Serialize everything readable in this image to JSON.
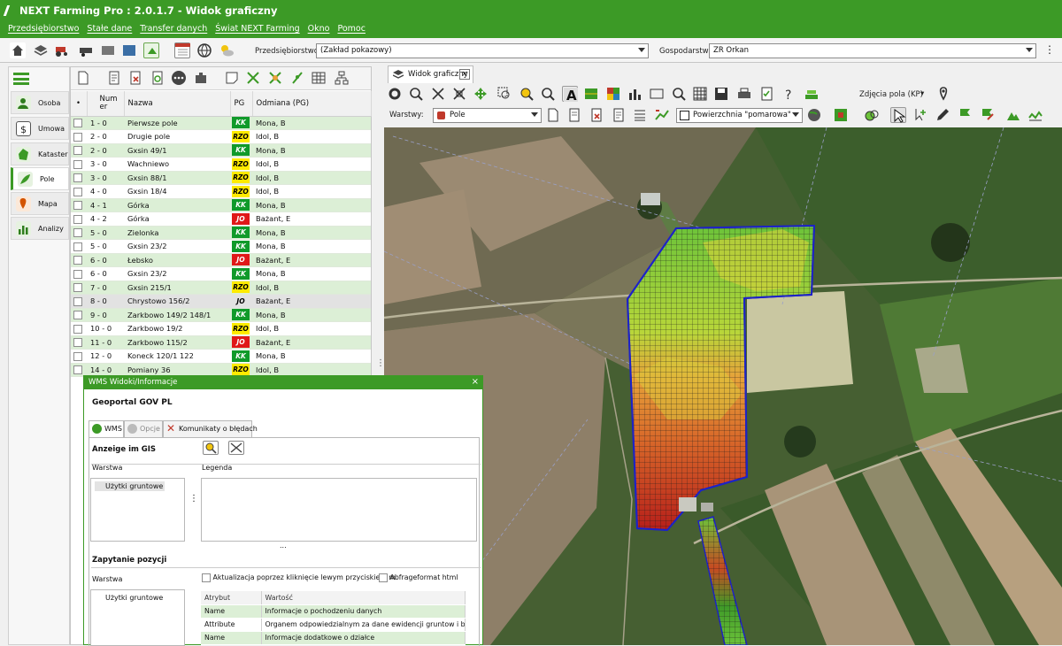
{
  "window": {
    "title": "NEXT Farming Pro : 2.0.1.7  - Widok graficzny"
  },
  "menu": [
    "Przedsiębiorstwo",
    "Stałe dane",
    "Transfer danych",
    "Świat NEXT Farming",
    "Okno",
    "Pomoc"
  ],
  "toolbar": {
    "enterprise_label": "Przedsiębiorstwo",
    "enterprise_value": "(Zakład pokazowy)",
    "farm_label": "Gospodarstwo",
    "farm_value": "ZR Orkan"
  },
  "nav": {
    "items": [
      {
        "label": "Osoba",
        "icon": "person-icon"
      },
      {
        "label": "Umowa",
        "icon": "contract-icon"
      },
      {
        "label": "Kataster",
        "icon": "cadastre-icon"
      },
      {
        "label": "Pole",
        "icon": "field-icon"
      },
      {
        "label": "Mapa",
        "icon": "map-icon"
      },
      {
        "label": "Analizy",
        "icon": "chart-icon"
      }
    ],
    "active": "Pole"
  },
  "fields_table": {
    "headers": [
      "Num er",
      "Nazwa",
      "PG",
      "Odmiana (PG)"
    ],
    "rows": [
      {
        "num": "1 - 0",
        "name": "Pierwsze pole",
        "pg": "KK",
        "variety": "Mona, B",
        "style": "g"
      },
      {
        "num": "2 - 0",
        "name": "Drugie pole",
        "pg": "RZO",
        "variety": "Idol, B",
        "style": "w"
      },
      {
        "num": "2 - 0",
        "name": "Gxsin 49/1",
        "pg": "KK",
        "variety": "Mona, B",
        "style": "g"
      },
      {
        "num": "3 - 0",
        "name": "Wachniewo",
        "pg": "RZO",
        "variety": "Idol, B",
        "style": "w"
      },
      {
        "num": "3 - 0",
        "name": "Gxsin 88/1",
        "pg": "RZO",
        "variety": "Idol, B",
        "style": "g"
      },
      {
        "num": "4 - 0",
        "name": "Gxsin 18/4",
        "pg": "RZO",
        "variety": "Idol, B",
        "style": "w"
      },
      {
        "num": "4 - 1",
        "name": "Górka",
        "pg": "KK",
        "variety": "Mona, B",
        "style": "g"
      },
      {
        "num": "4 - 2",
        "name": "Górka",
        "pg": "JO",
        "variety": "Bażant, E",
        "style": "w"
      },
      {
        "num": "5 - 0",
        "name": "Zielonka",
        "pg": "KK",
        "variety": "Mona, B",
        "style": "g"
      },
      {
        "num": "5 - 0",
        "name": "Gxsin 23/2",
        "pg": "KK",
        "variety": "Mona, B",
        "style": "w"
      },
      {
        "num": "6 - 0",
        "name": "Łebsko",
        "pg": "JO",
        "variety": "Bażant, E",
        "style": "g"
      },
      {
        "num": "6 - 0",
        "name": "Gxsin 23/2",
        "pg": "KK",
        "variety": "Mona, B",
        "style": "w"
      },
      {
        "num": "7 - 0",
        "name": "Gxsin 215/1",
        "pg": "RZO",
        "variety": "Idol, B",
        "style": "g"
      },
      {
        "num": "8 - 0",
        "name": "Chrystowo 156/2",
        "pg": "JOg",
        "pg_text": "JO",
        "variety": "Bażant, E",
        "style": "s"
      },
      {
        "num": "9 - 0",
        "name": "Zarkbowo 149/2 148/1",
        "pg": "KK",
        "variety": "Mona, B",
        "style": "g"
      },
      {
        "num": "10 - 0",
        "name": "Zarkbowo 19/2",
        "pg": "RZO",
        "variety": "Idol, B",
        "style": "w"
      },
      {
        "num": "11 - 0",
        "name": "Zarkbowo 115/2",
        "pg": "JO",
        "variety": "Bażant, E",
        "style": "g"
      },
      {
        "num": "12 - 0",
        "name": "Koneck 120/1 122",
        "pg": "KK",
        "variety": "Mona, B",
        "style": "w"
      },
      {
        "num": "14 - 0",
        "name": "Pomiany 36",
        "pg": "RZO",
        "variety": "Idol, B",
        "style": "g"
      }
    ]
  },
  "map": {
    "tab_label": "Widok graficzny",
    "layers_label": "Warstwy:",
    "layer_value": "Pole",
    "surface_value": "Powierzchnia \"pomarowa\"",
    "photos_label": "Zdjęcia pola (KP)"
  },
  "dialog": {
    "title": "WMS Widoki/Informacje",
    "provider": "Geoportal GOV PL",
    "tabs": [
      "WMS",
      "Opcje",
      "Komunikaty o błędach"
    ],
    "gis_label": "Anzeige im GIS",
    "layer_col": "Warstwa",
    "legend_col": "Legenda",
    "layer_item": "Użytki gruntowe",
    "ellipsis": "...",
    "query_label": "Zapytanie pozycji",
    "query_layer_col": "Warstwa",
    "query_layer_item": "Użytki gruntowe",
    "update_chk": "Aktualizacja poprzez kliknięcie lewym przyciskiem m",
    "format_chk": "Abfrageformat html",
    "attr_headers": [
      "Atrybut",
      "Wartość"
    ],
    "attrs": [
      {
        "k": "Name",
        "v": "Informacje o pochodzeniu danych",
        "style": "g"
      },
      {
        "k": "Attribute",
        "v": "Organem odpowiedzialnym za dane ewidencji gruntow i budynk",
        "style": "w"
      },
      {
        "k": "Name",
        "v": "Informacje dodatkowe o działce",
        "style": "g"
      }
    ]
  },
  "colors": {
    "brand": "#3c9a26",
    "kk": "#109a2a",
    "rzo": "#ffea00",
    "jo": "#e01818"
  }
}
